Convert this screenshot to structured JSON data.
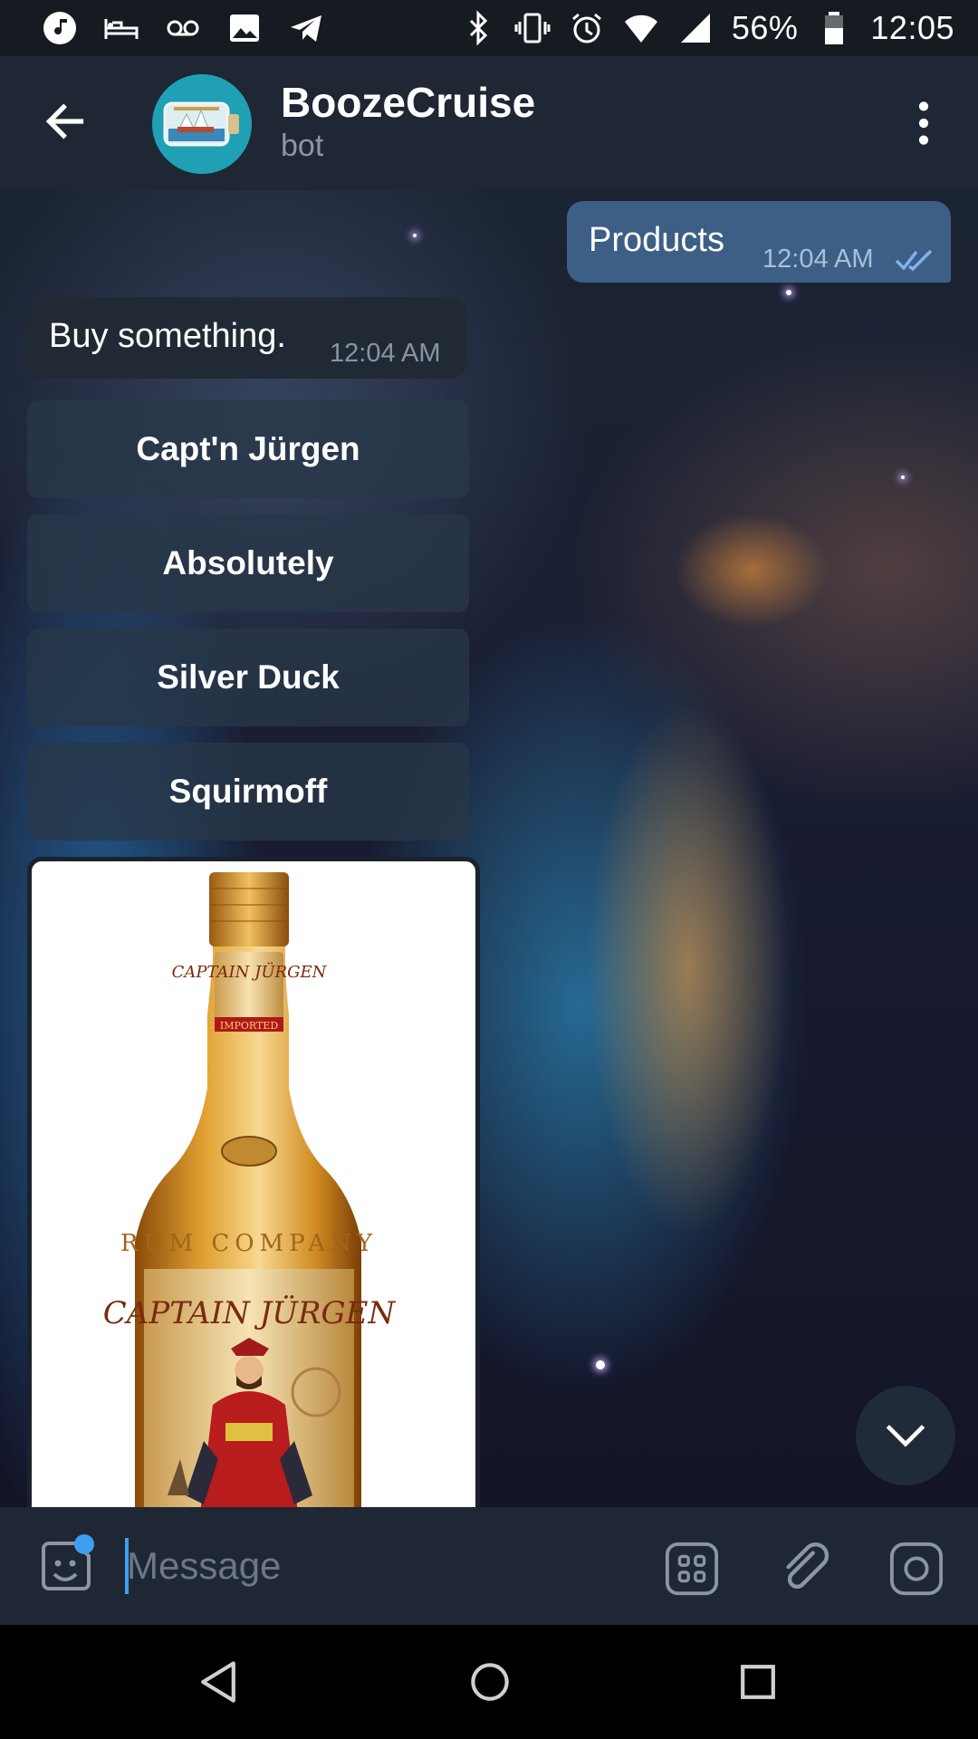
{
  "status_bar": {
    "battery": "56%",
    "time": "12:05",
    "left_icons": [
      "music-icon",
      "bed-icon",
      "voicemail-icon",
      "image-icon",
      "telegram-icon"
    ],
    "right_icons": [
      "bluetooth-icon",
      "vibrate-icon",
      "alarm-icon",
      "wifi-icon",
      "signal-icon",
      "battery-icon"
    ]
  },
  "header": {
    "title": "BoozeCruise",
    "subtitle": "bot",
    "avatar_color": "#1fa0b4"
  },
  "messages": {
    "outgoing": {
      "text": "Products",
      "time": "12:04 AM",
      "status": "read"
    },
    "incoming": {
      "text": "Buy something.",
      "time": "12:04 AM"
    }
  },
  "keyboard_buttons": [
    "Capt'n Jürgen",
    "Absolutely",
    "Silver Duck",
    "Squirmoff"
  ],
  "photo": {
    "label_top": "CAPTAIN JÜRGEN",
    "label_band": "IMPORTED",
    "label_rum": "RUM COMPANY",
    "label_main": "CAPTAIN JÜRGEN"
  },
  "input_bar": {
    "placeholder": "Message"
  },
  "colors": {
    "accent": "#3e9ff0",
    "header_bg": "#1e2733",
    "outgoing_bubble": "#3d5f86",
    "incoming_bubble": "#212a34"
  }
}
